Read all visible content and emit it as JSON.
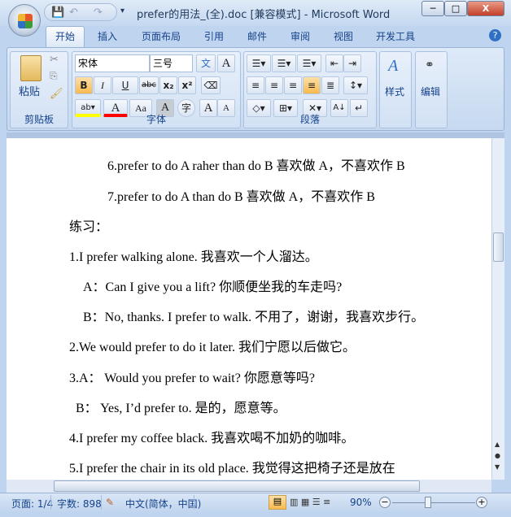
{
  "window": {
    "title": "prefer的用法_(全).doc [兼容模式] - Microsoft Word",
    "minimize": "─",
    "maximize": "□",
    "close": "X"
  },
  "tabs": [
    "开始",
    "插入",
    "页面布局",
    "引用",
    "邮件",
    "审阅",
    "视图",
    "开发工具"
  ],
  "ribbon": {
    "clipboard": {
      "label": "剪贴板",
      "paste": "粘贴"
    },
    "font": {
      "label": "字体",
      "font_name": "宋体",
      "font_size": "三号",
      "bold": "B",
      "italic": "I",
      "underline": "U",
      "strike": "abc",
      "sub": "x₂",
      "sup": "x²",
      "font_color": "A",
      "case": "Aa",
      "grow": "A",
      "shrink": "A",
      "char_shade": "A",
      "enclose": "字",
      "phonetic": "文",
      "border": "A"
    },
    "paragraph": {
      "label": "段落"
    },
    "styles": {
      "label": "样式"
    },
    "editing": {
      "label": "编辑"
    }
  },
  "document": {
    "lines": [
      "6.prefer to do A raher than do B  喜欢做 A，不喜欢作 B",
      "7.prefer to do A than do B  喜欢做 A，不喜欢作 B",
      "练习：",
      "1.I prefer walking alone.  我喜欢一个人溜达。",
      "A：Can I give you a lift?  你顺便坐我的车走吗?",
      "B：No, thanks. I prefer to walk.  不用了，谢谢，我喜欢步行。",
      "2.We would prefer to do it later.  我们宁愿以后做它。",
      "3.A：  Would you prefer to wait?  你愿意等吗?",
      "B：  Yes, I’d prefer to.  是的，愿意等。",
      "4.I prefer my coffee black.  我喜欢喝不加奶的咖啡。",
      "5.I  prefer  the  chair  in  its  old  place.  我觉得这把椅子还是放在"
    ]
  },
  "status": {
    "page": "页面: 1/4",
    "words": "字数: 898",
    "language": "中文(简体，中国)",
    "zoom": "90%"
  },
  "colors": {
    "accent": "#15428b",
    "highlight": "#ffff00",
    "font_color": "#ff0000"
  }
}
